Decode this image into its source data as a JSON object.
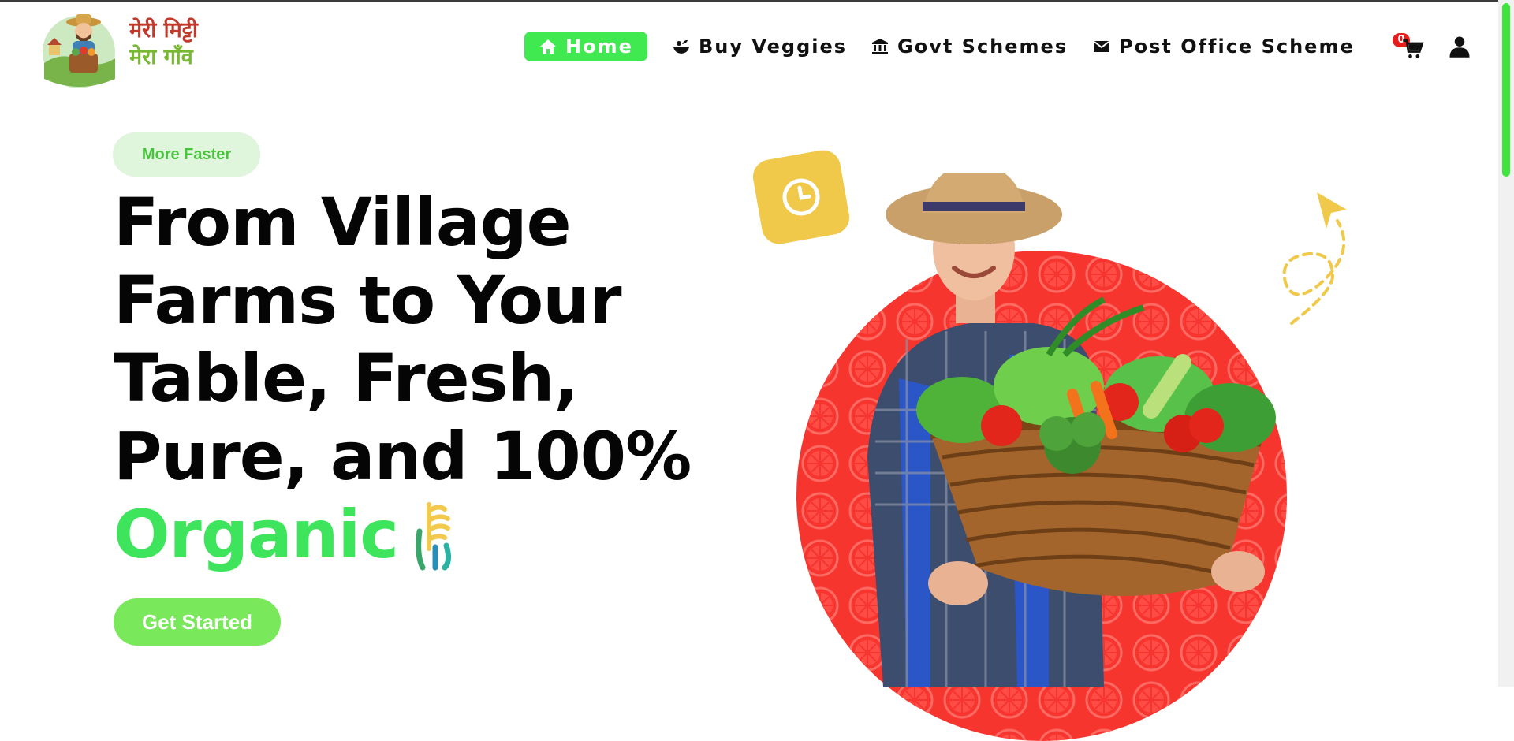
{
  "brand": {
    "name_line1": "मेरी मिट्टी",
    "name_line2": "मेरा गाँव"
  },
  "nav": {
    "items": [
      {
        "label": "Home",
        "icon": "home-icon",
        "active": true
      },
      {
        "label": "Buy Veggies",
        "icon": "veggie-bowl-icon",
        "active": false
      },
      {
        "label": "Govt Schemes",
        "icon": "bank-icon",
        "active": false
      },
      {
        "label": "Post Office Scheme",
        "icon": "envelope-icon",
        "active": false
      }
    ],
    "cart_count": "0",
    "cart_icon": "cart-icon",
    "user_icon": "user-icon"
  },
  "hero": {
    "tag": "More Faster",
    "headline_line1": "From Village",
    "headline_line2": "Farms to Your",
    "headline_line3": "Table, Fresh,",
    "headline_line4": "Pure, and 100%",
    "headline_highlight": "Organic",
    "cta_label": "Get Started"
  },
  "colors": {
    "accent_green": "#40e94f",
    "highlight_green": "#3ee55c",
    "cta_green": "#79e85a",
    "circle_red": "#f6352f",
    "clock_yellow": "#f0c84a"
  }
}
